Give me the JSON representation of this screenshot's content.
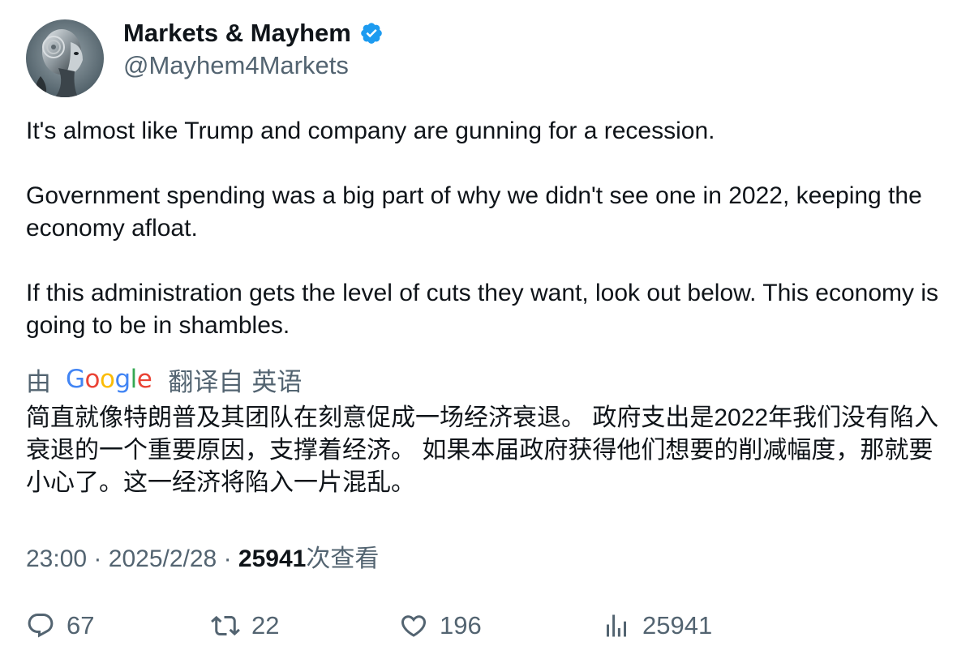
{
  "author": {
    "name": "Markets & Mayhem",
    "handle": "@Mayhem4Markets",
    "verified": true
  },
  "tweet": {
    "paragraphs": [
      "It's almost like Trump and company are gunning for a recession.",
      "Government spending was a big part of why we didn't see one in 2022, keeping the economy afloat.",
      "If this administration gets the level of cuts they want, look out below. This economy is going to be in shambles."
    ]
  },
  "translation": {
    "by_label": "由",
    "provider": "Google",
    "translated_from_label": "翻译自",
    "source_language": "英语",
    "text": "简直就像特朗普及其团队在刻意促成一场经济衰退。 政府支出是2022年我们没有陷入衰退的一个重要原因，支撑着经济。 如果本届政府获得他们想要的削减幅度，那就要小心了。这一经济将陷入一片混乱。"
  },
  "meta": {
    "time": "23:00",
    "separator": "·",
    "date": "2025/2/28",
    "views": "25941",
    "views_label": "次查看"
  },
  "actions": {
    "replies": "67",
    "retweets": "22",
    "likes": "196",
    "views": "25941"
  },
  "colors": {
    "text_primary": "#0f1419",
    "text_secondary": "#536471",
    "verified_badge": "#1d9bf0"
  },
  "icons": [
    "avatar-robot",
    "verified-badge-icon",
    "google-logo",
    "reply-icon",
    "retweet-icon",
    "like-icon",
    "views-icon"
  ]
}
